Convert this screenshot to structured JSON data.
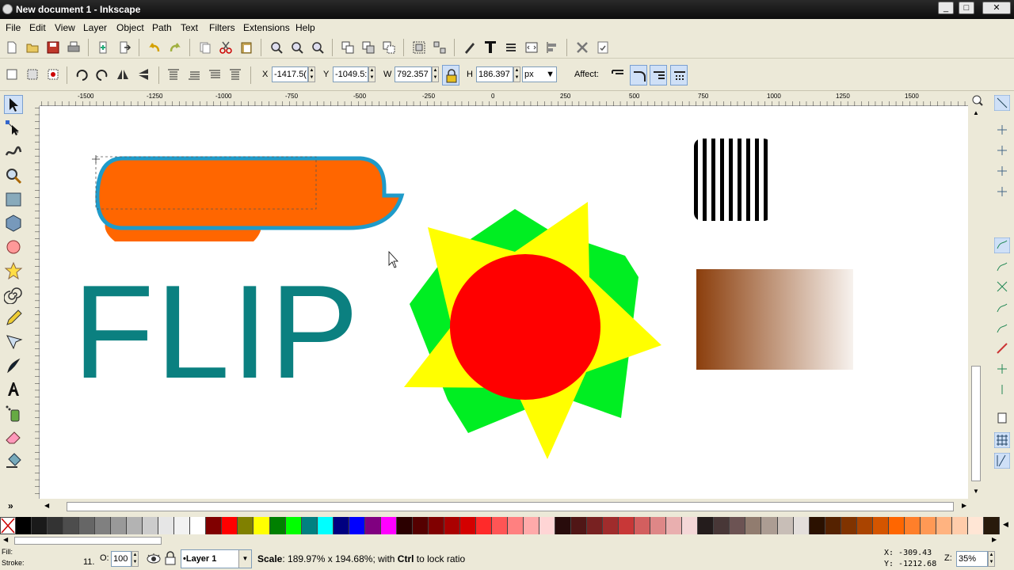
{
  "window": {
    "title": "New document 1 - Inkscape",
    "btn_min": "_",
    "btn_max": "□",
    "btn_close": "✕"
  },
  "menu": [
    "File",
    "Edit",
    "View",
    "Layer",
    "Object",
    "Path",
    "Text",
    "Filters",
    "Extensions",
    "Help"
  ],
  "controls": {
    "x_label": "X",
    "x_value": "-1417.5(",
    "y_label": "Y",
    "y_value": "-1049.5:",
    "w_label": "W",
    "w_value": "792.357",
    "h_label": "H",
    "h_value": "186.397",
    "unit": "px",
    "affect_label": "Affect:"
  },
  "ruler": {
    "labels": [
      "-1500",
      "-1250",
      "-1000",
      "-750",
      "-500",
      "-250",
      "0",
      "250",
      "500",
      "750",
      "1000",
      "1250",
      "1500"
    ]
  },
  "canvas": {
    "flip_text": "FLIP"
  },
  "palette": [
    "#000000",
    "#1a1a1a",
    "#333333",
    "#4d4d4d",
    "#666666",
    "#808080",
    "#999999",
    "#b3b3b3",
    "#cccccc",
    "#e6e6e6",
    "#f2f2f2",
    "#ffffff",
    "#800000",
    "#ff0000",
    "#808000",
    "#ffff00",
    "#008000",
    "#00ff00",
    "#008080",
    "#00ffff",
    "#000080",
    "#0000ff",
    "#800080",
    "#ff00ff",
    "#2b0000",
    "#550000",
    "#800000",
    "#aa0000",
    "#d40000",
    "#ff2a2a",
    "#ff5555",
    "#ff8080",
    "#ffaaaa",
    "#ffd5d5",
    "#280b0b",
    "#501616",
    "#782121",
    "#a02c2c",
    "#c83737",
    "#d35f5f",
    "#de8787",
    "#e9afaf",
    "#f4d7d7",
    "#241c1c",
    "#483737",
    "#6c5353",
    "#917c6f",
    "#ac9d93",
    "#c8beb7",
    "#e3dedb",
    "#2b1100",
    "#552200",
    "#803300",
    "#aa4400",
    "#d45500",
    "#ff6600",
    "#ff7f2a",
    "#ff9955",
    "#ffb380",
    "#ffccaa",
    "#ffe6d5",
    "#281a0b"
  ],
  "status": {
    "fill_label": "Fill:",
    "stroke_label": "Stroke:",
    "stroke_width": "11.",
    "opacity_label": "O:",
    "opacity_value": "100",
    "layer_value": "•Layer 1",
    "message_bold": "Scale",
    "message": ": 189.97% x 194.68%; with ",
    "message_ctrl": "Ctrl",
    "message_end": " to lock ratio",
    "x_coord": "X: -309.43",
    "y_coord": "Y: -1212.68",
    "zoom_label": "Z:",
    "zoom_value": "35%"
  }
}
